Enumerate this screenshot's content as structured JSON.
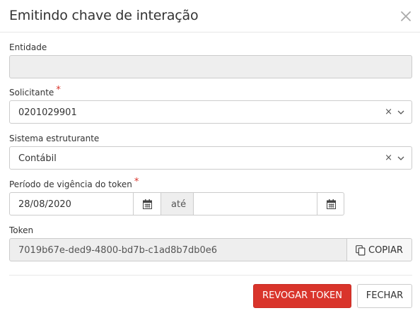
{
  "dialog": {
    "title": "Emitindo chave de interação",
    "close_icon": "close-icon"
  },
  "form": {
    "entidade": {
      "label": "Entidade",
      "value": ""
    },
    "solicitante": {
      "label": "Solicitante",
      "required_mark": "*",
      "value": "0201029901",
      "clear": "×"
    },
    "sistema": {
      "label": "Sistema estruturante",
      "value": "Contábil",
      "clear": "×"
    },
    "periodo": {
      "label": "Período de vigência do token",
      "required_mark": "*",
      "start_value": "28/08/2020",
      "separator": "até",
      "end_value": ""
    },
    "token": {
      "label": "Token",
      "value": "7019b67e-ded9-4800-bd7b-c1ad8b7db0e6",
      "copy_label": "COPIAR"
    }
  },
  "footer": {
    "revoke_label": "REVOGAR TOKEN",
    "close_label": "FECHAR"
  },
  "colors": {
    "danger": "#d9342b",
    "required": "#d9342b",
    "disabled_bg": "#eeeeee"
  }
}
